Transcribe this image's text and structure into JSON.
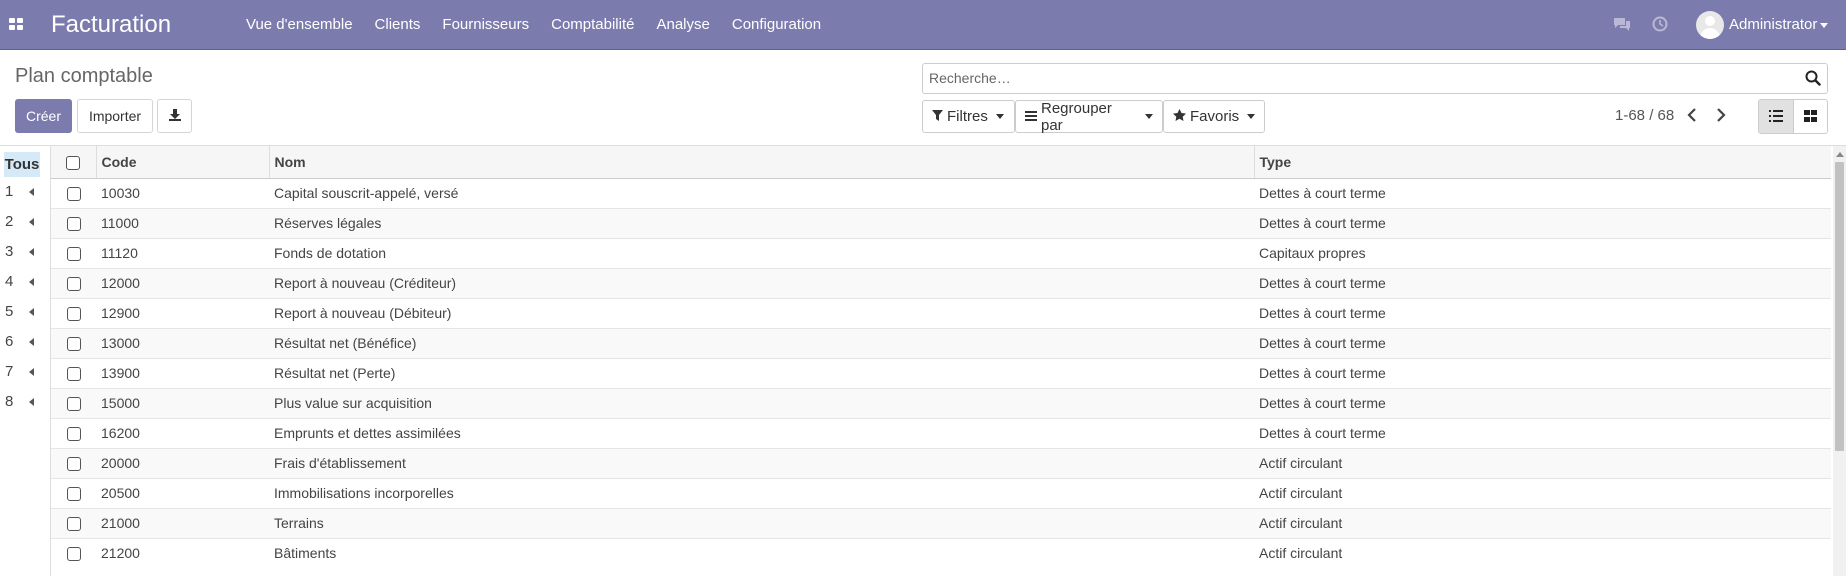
{
  "navbar": {
    "brand": "Facturation",
    "menu": [
      "Vue d'ensemble",
      "Clients",
      "Fournisseurs",
      "Comptabilité",
      "Analyse",
      "Configuration"
    ],
    "user": "Administrator",
    "bg_color": "#7c7bad"
  },
  "control": {
    "title": "Plan comptable",
    "create_label": "Créer",
    "import_label": "Importer",
    "search_placeholder": "Recherche…",
    "filters_label": "Filtres",
    "groupby_label": "Regrouper par",
    "favorites_label": "Favoris",
    "pager": "1-68 / 68"
  },
  "groups": {
    "all_label": "Tous",
    "items": [
      "1",
      "2",
      "3",
      "4",
      "5",
      "6",
      "7",
      "8"
    ]
  },
  "table": {
    "headers": {
      "code": "Code",
      "name": "Nom",
      "type": "Type"
    },
    "rows": [
      {
        "code": "10030",
        "name": "Capital souscrit-appelé, versé",
        "type": "Dettes à court terme"
      },
      {
        "code": "11000",
        "name": "Réserves légales",
        "type": "Dettes à court terme"
      },
      {
        "code": "11120",
        "name": "Fonds de dotation",
        "type": "Capitaux propres"
      },
      {
        "code": "12000",
        "name": "Report à nouveau (Créditeur)",
        "type": "Dettes à court terme"
      },
      {
        "code": "12900",
        "name": "Report à nouveau (Débiteur)",
        "type": "Dettes à court terme"
      },
      {
        "code": "13000",
        "name": "Résultat net (Bénéfice)",
        "type": "Dettes à court terme"
      },
      {
        "code": "13900",
        "name": "Résultat net (Perte)",
        "type": "Dettes à court terme"
      },
      {
        "code": "15000",
        "name": "Plus value sur acquisition",
        "type": "Dettes à court terme"
      },
      {
        "code": "16200",
        "name": "Emprunts et dettes assimilées",
        "type": "Dettes à court terme"
      },
      {
        "code": "20000",
        "name": "Frais d'établissement",
        "type": "Actif circulant"
      },
      {
        "code": "20500",
        "name": "Immobilisations incorporelles",
        "type": "Actif circulant"
      },
      {
        "code": "21000",
        "name": "Terrains",
        "type": "Actif circulant"
      },
      {
        "code": "21200",
        "name": "Bâtiments",
        "type": "Actif circulant"
      }
    ]
  },
  "icons": [
    "apps-icon",
    "chat-icon",
    "clock-icon",
    "download-icon",
    "search-icon",
    "filter-icon",
    "bars-icon",
    "star-icon",
    "chevron-left-icon",
    "chevron-right-icon",
    "list-view-icon",
    "kanban-view-icon"
  ]
}
